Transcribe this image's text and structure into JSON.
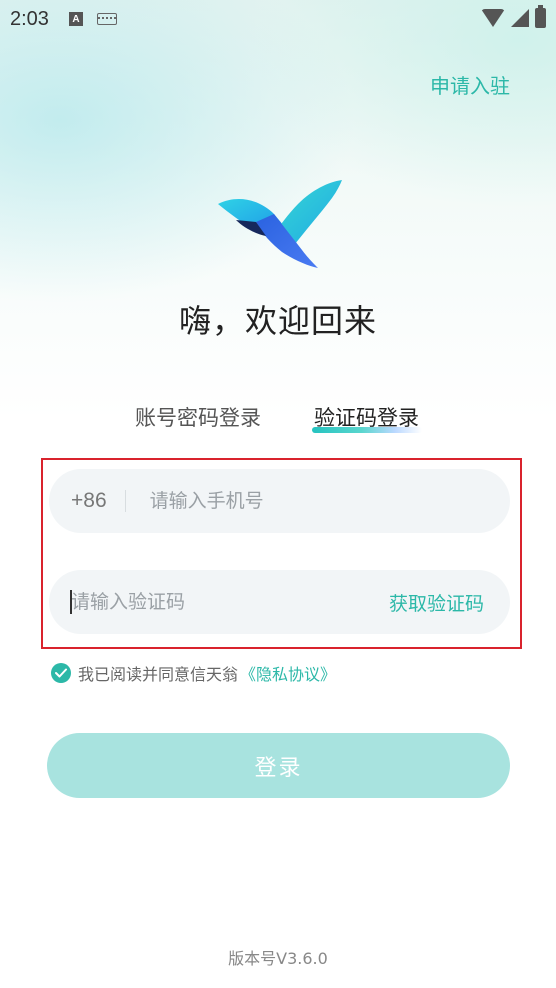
{
  "status_bar": {
    "time": "2:03",
    "notification_icon_letter": "A"
  },
  "header": {
    "apply_link": "申请入驻"
  },
  "welcome": {
    "title": "嗨，欢迎回来"
  },
  "tabs": [
    {
      "label": "账号密码登录",
      "active": false
    },
    {
      "label": "验证码登录",
      "active": true
    }
  ],
  "form": {
    "country_code": "+86",
    "phone_placeholder": "请输入手机号",
    "code_placeholder": "请输入验证码",
    "get_code_label": "获取验证码"
  },
  "agreement": {
    "checked": true,
    "text": "我已阅读并同意信天翁",
    "link": "《隐私协议》"
  },
  "login_button": {
    "label": "登录"
  },
  "footer": {
    "version": "版本号V3.6.0"
  },
  "colors": {
    "accent": "#2cb8a8",
    "button_disabled": "#a8e3df",
    "highlight_border": "#d9232d",
    "field_bg": "#f2f5f7"
  }
}
